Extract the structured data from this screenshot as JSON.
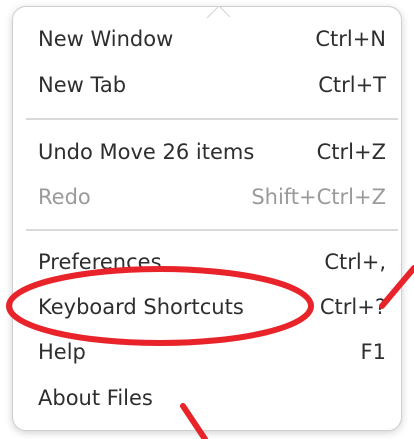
{
  "menu": {
    "group1": [
      {
        "label": "New Window",
        "shortcut": "Ctrl+N"
      },
      {
        "label": "New Tab",
        "shortcut": "Ctrl+T"
      }
    ],
    "group2": [
      {
        "label": "Undo Move 26 items",
        "shortcut": "Ctrl+Z"
      },
      {
        "label": "Redo",
        "shortcut": "Shift+Ctrl+Z",
        "disabled": true
      }
    ],
    "group3": [
      {
        "label": "Preferences",
        "shortcut": "Ctrl+,"
      },
      {
        "label": "Keyboard Shortcuts",
        "shortcut": "Ctrl+?"
      },
      {
        "label": "Help",
        "shortcut": "F1"
      },
      {
        "label": "About Files",
        "shortcut": ""
      }
    ]
  },
  "annotation": {
    "color": "#e8242a",
    "highlighted_item": "Keyboard Shortcuts"
  }
}
